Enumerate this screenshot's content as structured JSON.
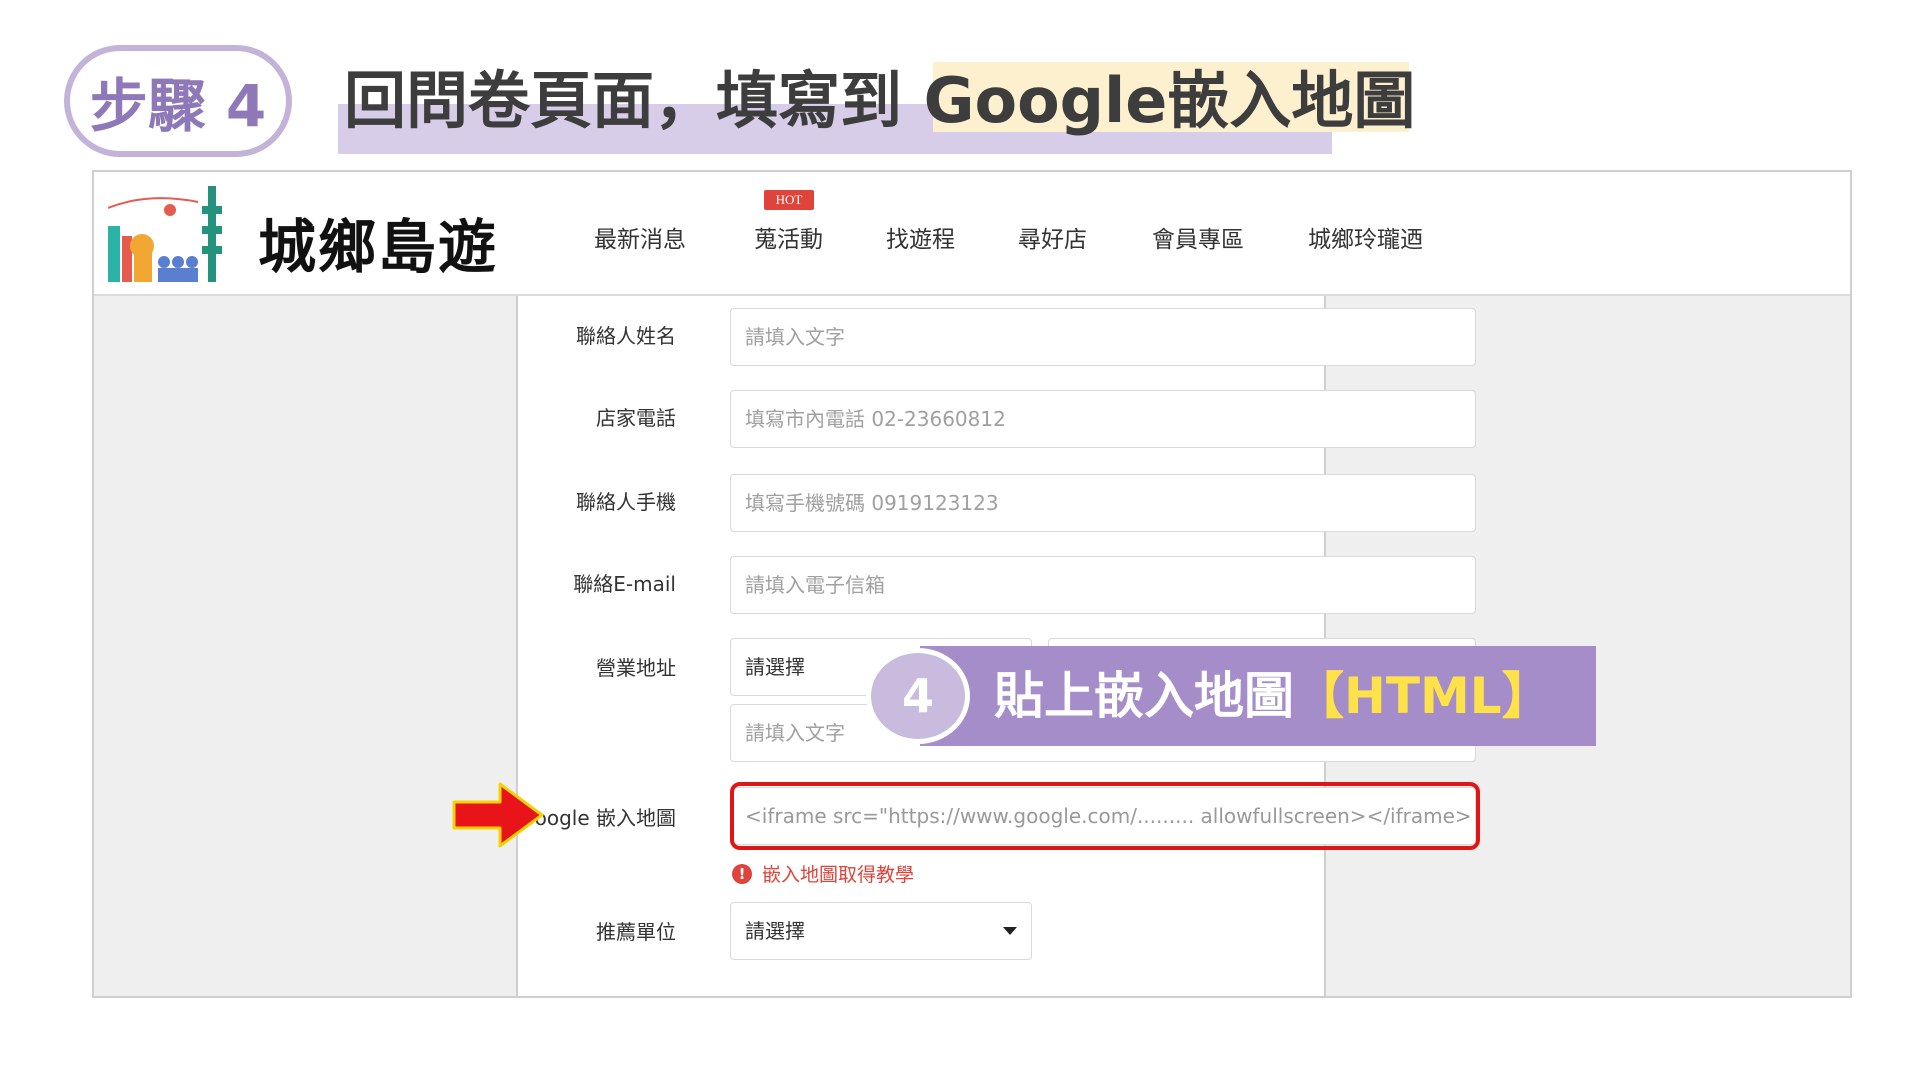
{
  "step": {
    "badge": "步驟 4",
    "title_prefix": "回問卷頁面，填寫到 ",
    "title_highlight": "Google嵌入地圖"
  },
  "site": {
    "logo_text": "城鄉島遊",
    "nav": [
      "最新消息",
      "蒐活動",
      "找遊程",
      "尋好店",
      "會員專區",
      "城鄉玲瓏迺"
    ],
    "hot_badge": "HOT"
  },
  "form": {
    "contact_name": {
      "label": "聯絡人姓名",
      "placeholder": "請填入文字"
    },
    "shop_phone": {
      "label": "店家電話",
      "placeholder": "填寫市內電話 02-23660812"
    },
    "contact_mobile": {
      "label": "聯絡人手機",
      "placeholder": "填寫手機號碼 0919123123"
    },
    "contact_email": {
      "label": "聯絡E-mail",
      "placeholder": "請填入電子信箱"
    },
    "business_address": {
      "label": "營業地址",
      "select_value": "請選擇",
      "placeholder": "請填入文字"
    },
    "google_map": {
      "label": "Google 嵌入地圖",
      "placeholder": "<iframe src=\"https://www.google.com/......... allowfullscreen></iframe>"
    },
    "map_help_link": "嵌入地圖取得教學",
    "recommend_unit": {
      "label": "推薦單位",
      "select_value": "請選擇"
    }
  },
  "callout": {
    "number": "4",
    "text": "貼上嵌入地圖",
    "accent": "【HTML】"
  },
  "colors": {
    "badge_border": "#c3b3d9",
    "badge_text": "#8e78b8",
    "callout_bg": "#a48dc8",
    "accent_yellow": "#ffe24a",
    "highlight_red": "#e01616",
    "hot_red": "#e0433a"
  }
}
